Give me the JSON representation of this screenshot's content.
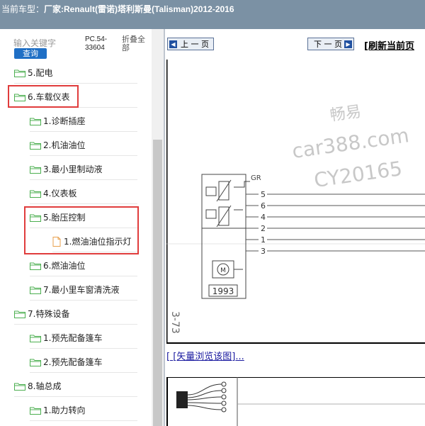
{
  "header": {
    "prefix": "当前车型：",
    "model_label": "厂家:Renault(雷诺)塔利斯曼(Talisman)2012-2016"
  },
  "search": {
    "placeholder": "输入关键字",
    "query_label": "查询",
    "pc_code": "PC.54-33604",
    "collapse_all": "折叠全部"
  },
  "tree": [
    {
      "label": "5.配电",
      "icon": "folder-icon"
    },
    {
      "label": "6.车载仪表",
      "icon": "folder-icon",
      "highlighted": true
    },
    {
      "label": "1.诊断插座",
      "icon": "folder-icon"
    },
    {
      "label": "2.机油油位",
      "icon": "folder-icon"
    },
    {
      "label": "3.最小里制动液",
      "icon": "folder-icon"
    },
    {
      "label": "4.仪表板",
      "icon": "folder-icon"
    },
    {
      "label": "5.胎压控制",
      "icon": "folder-icon",
      "highlighted": true
    },
    {
      "label": "1.燃油油位指示灯",
      "icon": "file-icon",
      "highlighted": true
    },
    {
      "label": "6.燃油油位",
      "icon": "folder-icon"
    },
    {
      "label": "7.最小里车窗清洗液",
      "icon": "folder-icon"
    },
    {
      "label": "7.特殊设备",
      "icon": "folder-icon"
    },
    {
      "label": "1.预先配备篷车",
      "icon": "folder-icon"
    },
    {
      "label": "2.预先配备篷车",
      "icon": "folder-icon"
    },
    {
      "label": "8.轴总成",
      "icon": "folder-icon"
    },
    {
      "label": "1.助力转向",
      "icon": "folder-icon"
    }
  ],
  "nav": {
    "prev_label": "上 一 页",
    "next_label": "下 一 页",
    "refresh_label": "[刷新当前页"
  },
  "diagram": {
    "wire_label": "GR",
    "pins": [
      "5",
      "6",
      "4",
      "2",
      "1",
      "3"
    ],
    "motor_label": "M",
    "component_code": "1993",
    "page_ref": "3-73",
    "watermark": [
      "畅易",
      "car388.com",
      "CY20165"
    ]
  },
  "vector_link": {
    "open": "[ ",
    "label": "[矢量浏览该图]",
    "trail": "..."
  },
  "colors": {
    "titlebar": "#7b91a4",
    "folder": "#4caf50",
    "highlight": "#e03c3c",
    "query_button": "#1f6fc5"
  }
}
